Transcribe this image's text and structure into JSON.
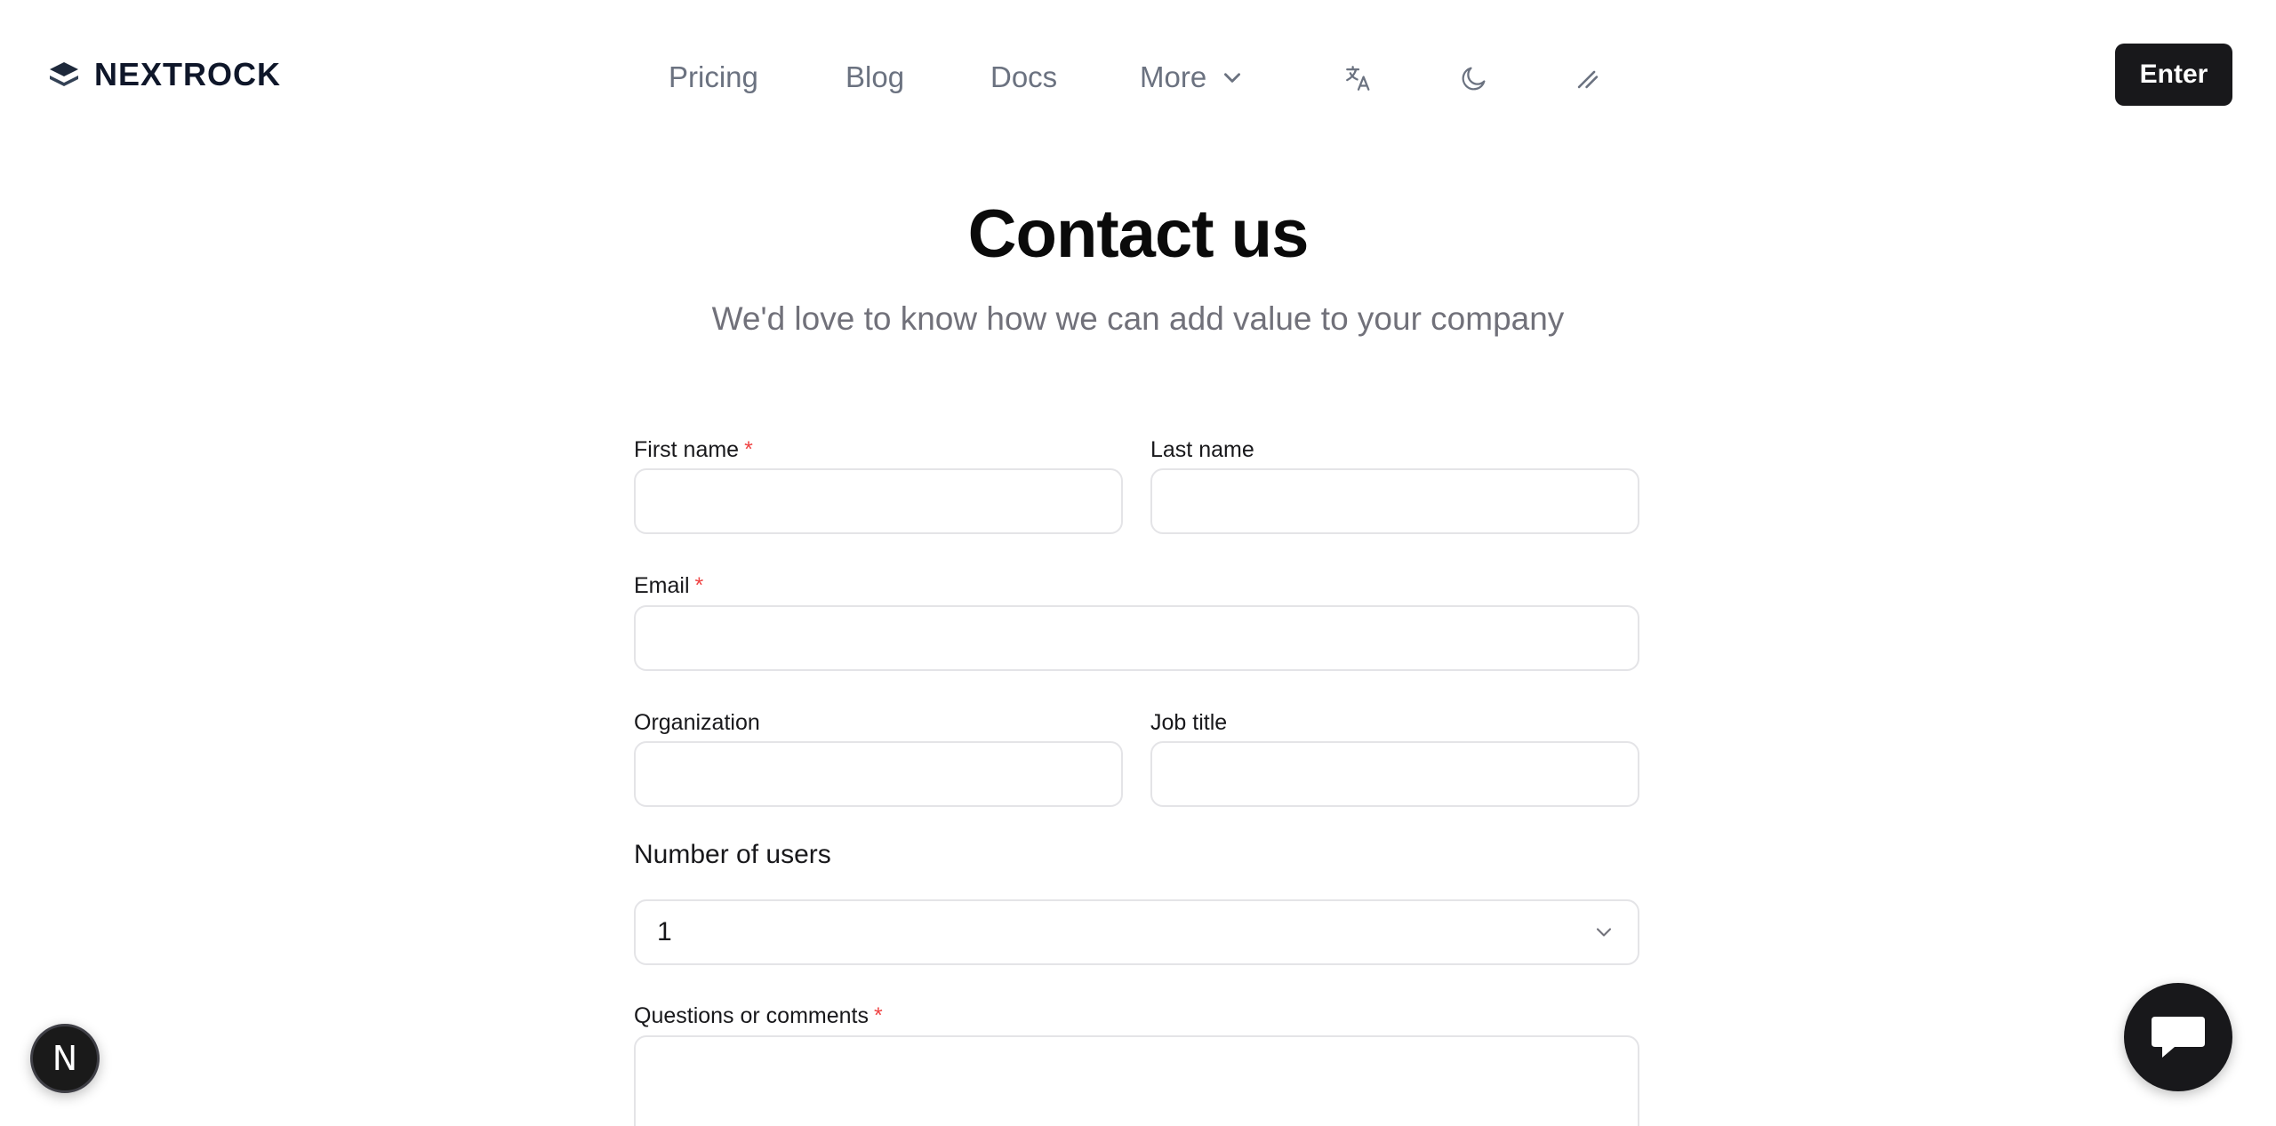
{
  "brand": {
    "name": "NEXTROCK",
    "icon": "layers-icon"
  },
  "nav": {
    "items": [
      {
        "label": "Pricing"
      },
      {
        "label": "Blog"
      },
      {
        "label": "Docs"
      },
      {
        "label": "More"
      }
    ],
    "icons": [
      "translate-icon",
      "moon-icon",
      "slash-icon"
    ],
    "enter_label": "Enter"
  },
  "page": {
    "title": "Contact us",
    "subtitle": "We'd love to know how we can add value to your company"
  },
  "form": {
    "first_name": {
      "label": "First name",
      "required": "*",
      "value": ""
    },
    "last_name": {
      "label": "Last name",
      "value": ""
    },
    "email": {
      "label": "Email",
      "required": "*",
      "value": ""
    },
    "organization": {
      "label": "Organization",
      "value": ""
    },
    "job_title": {
      "label": "Job title",
      "value": ""
    },
    "users": {
      "label": "Number of users",
      "selected": "1"
    },
    "comments": {
      "label": "Questions or comments",
      "required": "*",
      "value": ""
    }
  },
  "floating": {
    "badge_letter": "N",
    "chat_icon": "chat-icon"
  },
  "colors": {
    "accent": "#18181b",
    "required": "#ef4444",
    "muted": "#71717a"
  }
}
